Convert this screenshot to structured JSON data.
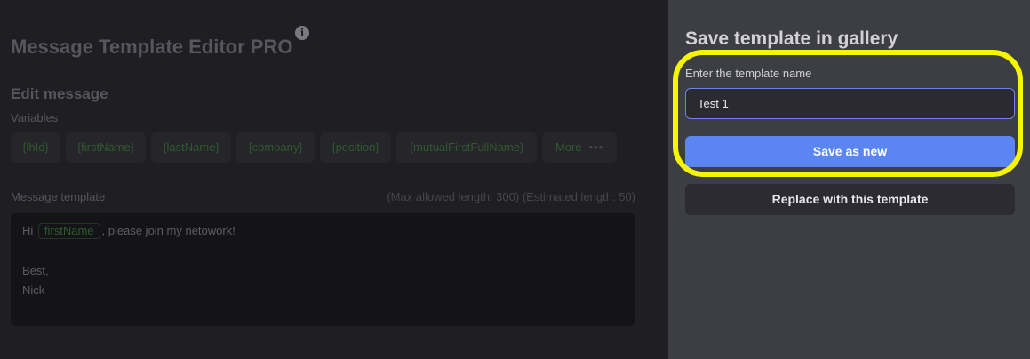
{
  "editor": {
    "title": "Message Template Editor PRO",
    "info_icon": "info-icon",
    "section_title": "Edit message",
    "variables_label": "Variables",
    "variables": [
      "{lhId}",
      "{firstName}",
      "{lastName}",
      "{company}",
      "{position}",
      "{mutualFirstFullName}"
    ],
    "more_label": "More",
    "more_icon": "more-dots-icon",
    "template_label": "Message template",
    "template_meta": "(Max allowed length: 300) (Estimated length: 50)",
    "template": {
      "greeting": "Hi",
      "variable": "firstName",
      "rest": ", please join my netowork!",
      "sign_off": "Best,",
      "signature": "Nick"
    }
  },
  "panel": {
    "title": "Save template in gallery",
    "name_label": "Enter the template name",
    "name_value": "Test 1",
    "save_label": "Save as new",
    "replace_label": "Replace with this template"
  },
  "colors": {
    "accent": "#5b86f2",
    "highlight": "#f5f500",
    "variable_green": "#2f5a2f"
  }
}
